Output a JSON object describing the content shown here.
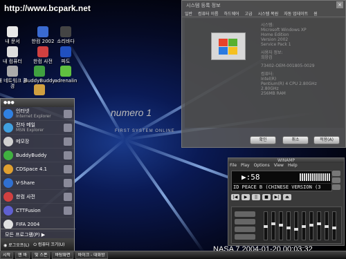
{
  "watermark": "http://www.bcpark.net",
  "desktop_icons": [
    {
      "label": "내 문서",
      "color": "#e8e8e8"
    },
    {
      "label": "한컴 2002",
      "color": "#3a6ad0"
    },
    {
      "label": "소리바다",
      "color": "#444"
    },
    {
      "label": "내 컴퓨터",
      "color": "#ddd"
    },
    {
      "label": "한컴 사전",
      "color": "#d04040"
    },
    {
      "label": "파도",
      "color": "#2050c0"
    },
    {
      "label": "내 네트워크 환경",
      "color": "#aaa"
    },
    {
      "label": "BuddyBuddy",
      "color": "#40a040"
    },
    {
      "label": "adrenalin",
      "color": "#60c040"
    },
    {
      "label": "",
      "color": "#d0a040"
    }
  ],
  "boot_logo": {
    "brand": "numero 1",
    "tagline": "FIRST SYSTEM ONLINE"
  },
  "start_menu": {
    "header": "●●●",
    "items": [
      {
        "title": "인터넷",
        "subtitle": "Internet Explorer",
        "color": "#3080e0"
      },
      {
        "title": "전자 메일",
        "subtitle": "MSN Explorer",
        "color": "#40a0e0"
      },
      {
        "title": "메모장",
        "subtitle": "",
        "color": "#d0d0d0"
      },
      {
        "title": "BuddyBuddy",
        "subtitle": "",
        "color": "#40b040"
      },
      {
        "title": "CDSpace 4.1",
        "subtitle": "",
        "color": "#e0a030"
      },
      {
        "title": "V-Share",
        "subtitle": "",
        "color": "#3070d0"
      },
      {
        "title": "한컴 사전",
        "subtitle": "",
        "color": "#d04040"
      },
      {
        "title": "CTTFusion",
        "subtitle": "",
        "color": "#6060d0"
      },
      {
        "title": "FIFA 2004",
        "subtitle": "",
        "color": "#e0e0e0"
      }
    ],
    "all_programs": "모든 프로그램(P) ▶",
    "logoff": "로그오프(L)",
    "shutdown": "컴퓨터 끄기(U)"
  },
  "system_properties": {
    "title": "시스템 등록 정보",
    "close": "×",
    "tabs": [
      "일반",
      "컴퓨터 이름",
      "하드웨어",
      "고급",
      "시스템 복원",
      "자동 업데이트",
      "원"
    ],
    "info_lines": [
      "시스템:",
      "Microsoft Windows XP",
      "Home Edition",
      "Version 2002",
      "Service Pack 1",
      "",
      "사용자 정보:",
      "희망검",
      "",
      "73402-OEM-001805-0029",
      "",
      "컴퓨터:",
      "Intel(R)",
      "Pentium(R) 4 CPU 2.80GHz",
      "2.80GHz",
      "256MB RAM"
    ],
    "ok": "확인",
    "cancel": "취소",
    "apply": "적용(A)"
  },
  "winamp": {
    "title": "WINAMP",
    "menu": [
      "File",
      "Play",
      "Options",
      "View",
      "Help"
    ],
    "time": "▶:58",
    "song": "ID PEACE B (CHINESE VERSION (3",
    "controls": [
      "|◀",
      "▶",
      "||",
      "■",
      "▶|",
      "⏏"
    ],
    "eq_levels": [
      0.5,
      0.6,
      0.55,
      0.45,
      0.4,
      0.5,
      0.55,
      0.6,
      0.5,
      0.45
    ]
  },
  "stamp": "NASA  7 2004-01-20 00:03:32",
  "taskbar": {
    "buttons": [
      "시작",
      "엔 바",
      "빛 스폰",
      "바탕화면",
      "바이크 - 대화방"
    ]
  }
}
